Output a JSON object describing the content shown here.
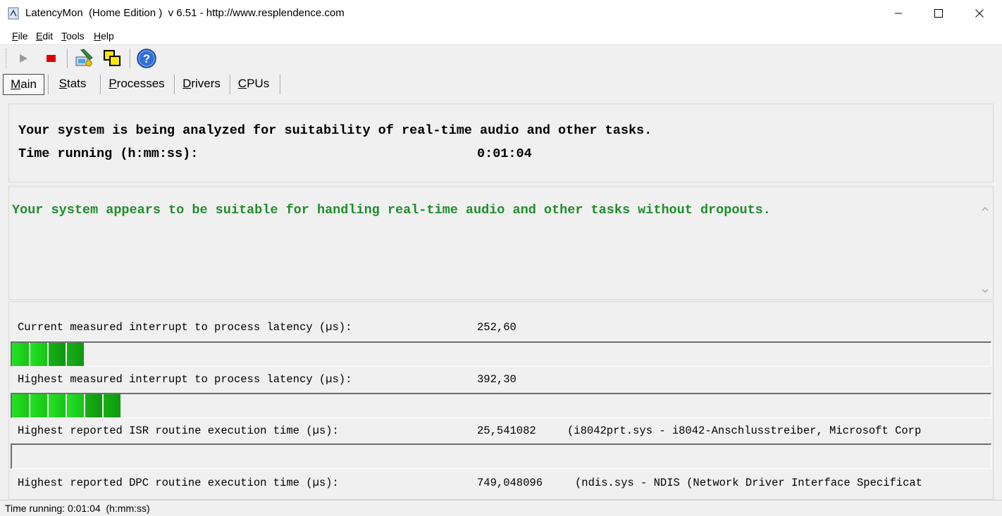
{
  "window": {
    "title": "LatencyMon  (Home Edition )  v 6.51 - http://www.resplendence.com"
  },
  "menu": [
    {
      "underline": "F",
      "rest": "ile"
    },
    {
      "underline": "E",
      "rest": "dit"
    },
    {
      "underline": "T",
      "rest": "ools"
    },
    {
      "underline": "H",
      "rest": "elp"
    }
  ],
  "toolbar": {
    "icons": [
      "play-icon",
      "stop-icon",
      "tools-icon",
      "windows-icon",
      "help-icon"
    ]
  },
  "tabs": [
    {
      "underline": "M",
      "rest": "ain",
      "active": true
    },
    {
      "underline": "S",
      "rest": "tats",
      "active": false
    },
    {
      "underline": "P",
      "rest": "rocesses",
      "active": false
    },
    {
      "underline": "D",
      "rest": "rivers",
      "active": false
    },
    {
      "underline": "C",
      "rest": "PUs",
      "active": false
    }
  ],
  "status": {
    "line1": "Your system is being analyzed for suitability of real-time audio and other tasks.",
    "time_label": "Time running (h:mm:ss):",
    "time_value": "0:01:04"
  },
  "verdict": {
    "text": "Your system appears to be suitable for handling real-time audio and other tasks without dropouts.",
    "color": "#1e8e2a"
  },
  "metrics": [
    {
      "label": "Current measured interrupt to process latency (µs):",
      "value": "252,60",
      "detail": "",
      "level_segments": 4
    },
    {
      "label": "Highest measured interrupt to process latency (µs):",
      "value": "392,30",
      "detail": "",
      "level_segments": 6
    },
    {
      "label": "Highest reported ISR routine execution time (µs):",
      "value": "25,541082",
      "detail": "(i8042prt.sys - i8042-Anschlusstreiber, Microsoft Corp",
      "level_segments": 0
    },
    {
      "label": "Highest reported DPC routine execution time (µs):",
      "value": "749,048096",
      "detail": "(ndis.sys - NDIS (Network Driver Interface Specificat",
      "level_segments": null
    }
  ],
  "statusbar": {
    "text": "Time running: 0:01:04  (h:mm:ss)"
  },
  "colors": {
    "bar_green": "#23e223",
    "bar_dark_green": "#0f960f",
    "stop_red": "#e00000"
  }
}
